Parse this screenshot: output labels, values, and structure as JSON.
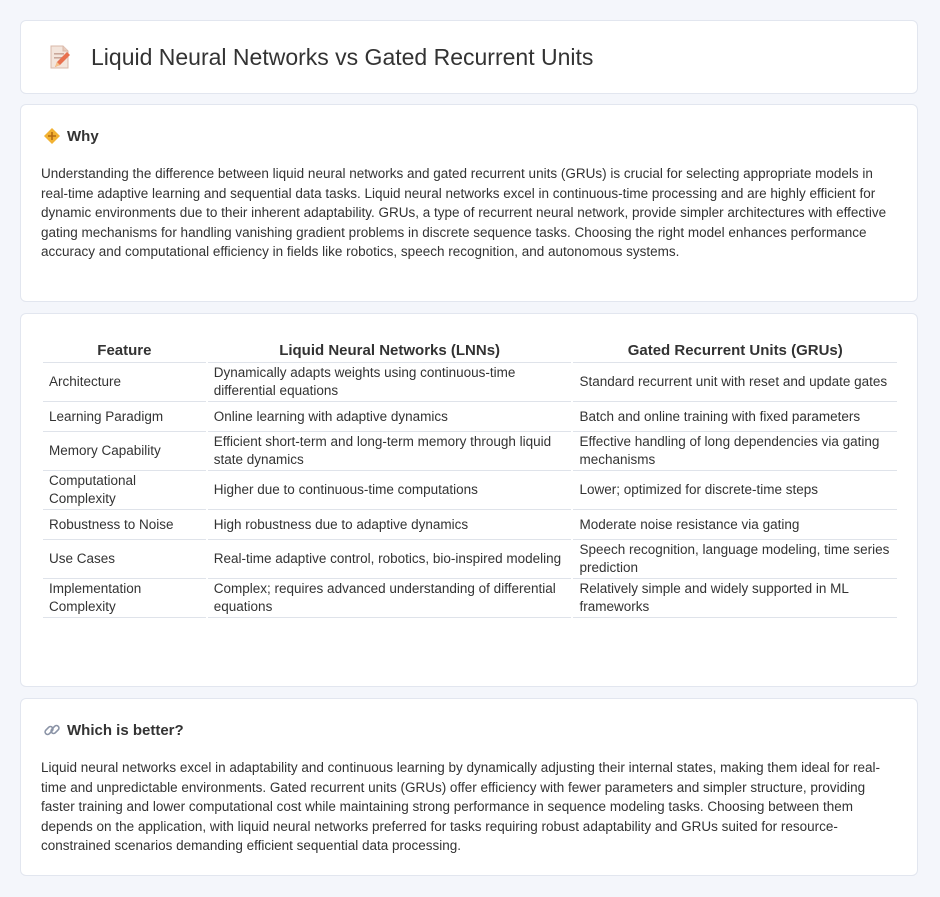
{
  "header": {
    "title": "Liquid Neural Networks vs Gated Recurrent Units",
    "icon": "document-pencil-icon"
  },
  "why": {
    "icon": "diamond-arrows-icon",
    "heading": "Why",
    "body": "Understanding the difference between liquid neural networks and gated recurrent units (GRUs) is crucial for selecting appropriate models in real-time adaptive learning and sequential data tasks. Liquid neural networks excel in continuous-time processing and are highly efficient for dynamic environments due to their inherent adaptability. GRUs, a type of recurrent neural network, provide simpler architectures with effective gating mechanisms for handling vanishing gradient problems in discrete sequence tasks. Choosing the right model enhances performance accuracy and computational efficiency in fields like robotics, speech recognition, and autonomous systems."
  },
  "table": {
    "headers": [
      "Feature",
      "Liquid Neural Networks (LNNs)",
      "Gated Recurrent Units (GRUs)"
    ],
    "rows": [
      [
        "Architecture",
        "Dynamically adapts weights using continuous-time differential equations",
        "Standard recurrent unit with reset and update gates"
      ],
      [
        "Learning Paradigm",
        "Online learning with adaptive dynamics",
        "Batch and online training with fixed parameters"
      ],
      [
        "Memory Capability",
        "Efficient short-term and long-term memory through liquid state dynamics",
        "Effective handling of long dependencies via gating mechanisms"
      ],
      [
        "Computational Complexity",
        "Higher due to continuous-time computations",
        "Lower; optimized for discrete-time steps"
      ],
      [
        "Robustness to Noise",
        "High robustness due to adaptive dynamics",
        "Moderate noise resistance via gating"
      ],
      [
        "Use Cases",
        "Real-time adaptive control, robotics, bio-inspired modeling",
        "Speech recognition, language modeling, time series prediction"
      ],
      [
        "Implementation Complexity",
        "Complex; requires advanced understanding of differential equations",
        "Relatively simple and widely supported in ML frameworks"
      ]
    ]
  },
  "better": {
    "icon": "link-icon",
    "heading": "Which is better?",
    "body": "Liquid neural networks excel in adaptability and continuous learning by dynamically adjusting their internal states, making them ideal for real-time and unpredictable environments. Gated recurrent units (GRUs) offer efficiency with fewer parameters and simpler structure, providing faster training and lower computational cost while maintaining strong performance in sequence modeling tasks. Choosing between them depends on the application, with liquid neural networks preferred for tasks requiring robust adaptability and GRUs suited for resource-constrained scenarios demanding efficient sequential data processing."
  }
}
